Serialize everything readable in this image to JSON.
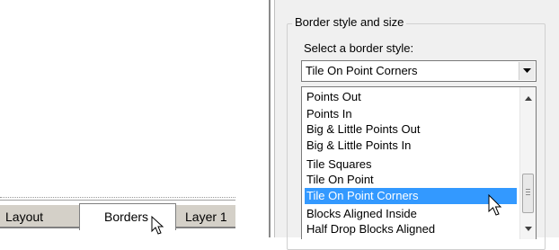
{
  "tabs": {
    "items": [
      {
        "label": "Layout"
      },
      {
        "label": "Borders"
      },
      {
        "label": "Layer 1"
      }
    ],
    "active": "Borders"
  },
  "border_group": {
    "title": "Border style and size",
    "select_label": "Select a border style:",
    "combo_value": "Tile On Point Corners",
    "list": [
      "Points Out",
      "Points In",
      "Big & Little Points Out",
      "Big & Little Points In",
      "Tile Squares",
      "Tile On Point",
      "Tile On Point Corners",
      "Blocks Aligned Inside",
      "Half Drop Blocks Aligned"
    ],
    "selected_item": "Tile On Point Corners"
  },
  "colors": {
    "selection_bg": "#3399ff",
    "panel_bg": "#f0f0f0",
    "tab_bg": "#d4d0c8"
  },
  "icons": [
    "mouse-cursor-icon",
    "dropdown-arrow-icon",
    "scroll-up-arrow-icon",
    "scroll-down-arrow-icon"
  ]
}
